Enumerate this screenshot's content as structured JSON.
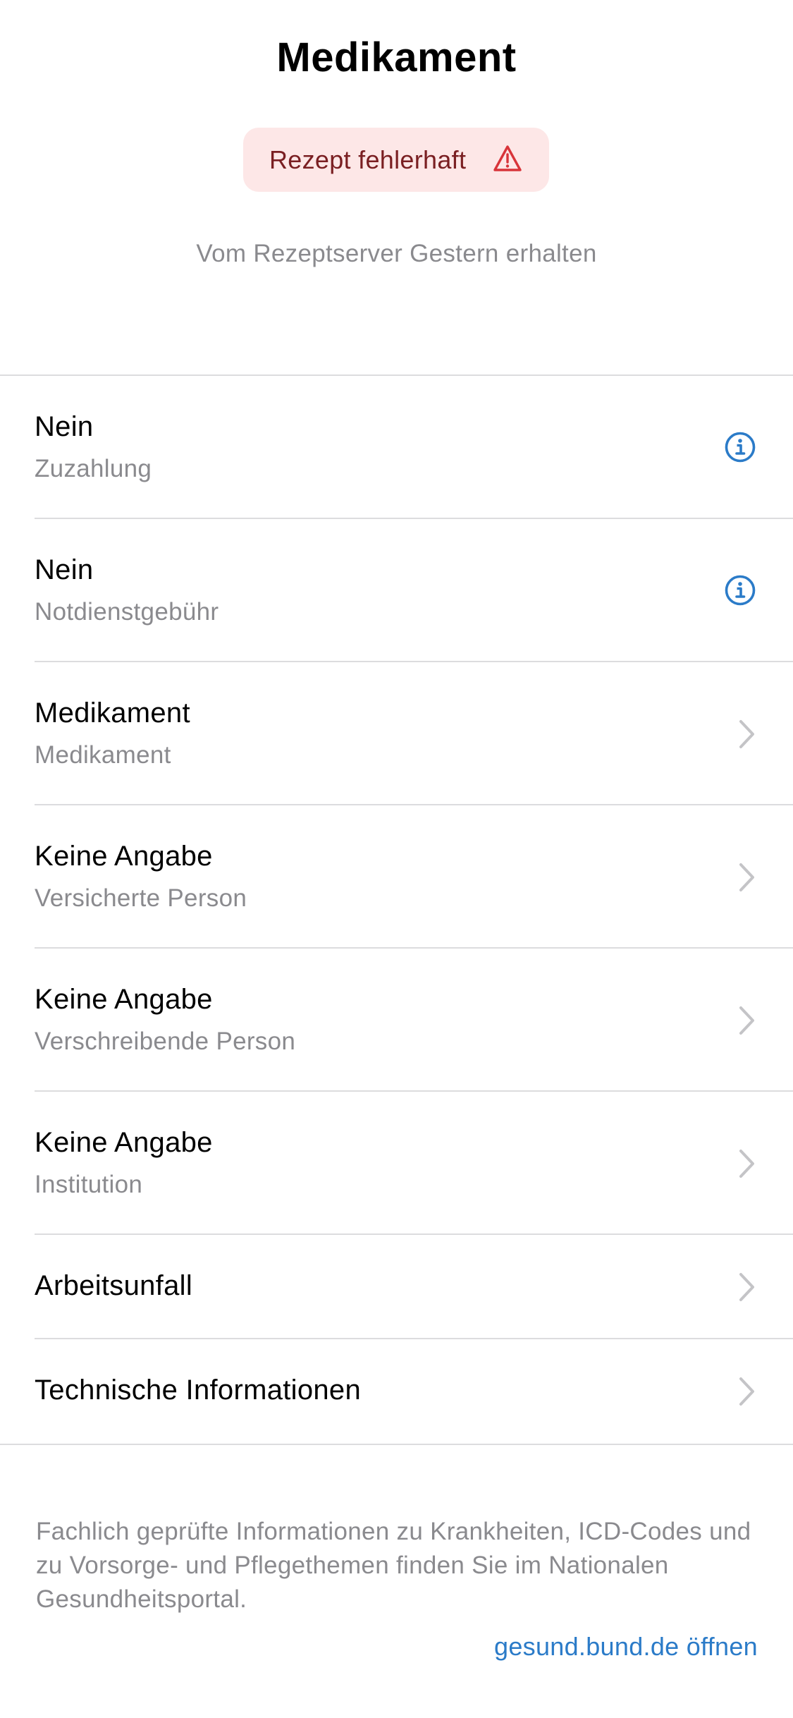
{
  "header": {
    "title": "Medikament"
  },
  "status": {
    "label": "Rezept fehlerhaft",
    "icon": "warning-triangle-icon",
    "color": "#d8343a",
    "background": "#fde7e7"
  },
  "received_text": "Vom Rezeptserver Gestern erhalten",
  "rows": [
    {
      "primary": "Nein",
      "secondary": "Zuzahlung",
      "accessory": "info-icon"
    },
    {
      "primary": "Nein",
      "secondary": "Notdienstgebühr",
      "accessory": "info-icon"
    },
    {
      "primary": "Medikament",
      "secondary": "Medikament",
      "accessory": "chevron-right-icon"
    },
    {
      "primary": "Keine Angabe",
      "secondary": "Versicherte Person",
      "accessory": "chevron-right-icon"
    },
    {
      "primary": "Keine Angabe",
      "secondary": "Verschreibende Person",
      "accessory": "chevron-right-icon"
    },
    {
      "primary": "Keine Angabe",
      "secondary": "Institution",
      "accessory": "chevron-right-icon"
    },
    {
      "primary": "Arbeitsunfall",
      "accessory": "chevron-right-icon"
    },
    {
      "primary": "Technische Informationen",
      "accessory": "chevron-right-icon"
    }
  ],
  "footer": {
    "text": "Fachlich geprüfte Informationen zu Krankheiten, ICD-Codes und zu Vorsorge- und Pflegethemen finden Sie im Nationalen Gesundheitsportal.",
    "link_label": "gesund.bund.de öffnen"
  },
  "colors": {
    "accent": "#2b7bc8",
    "secondary_text": "#8a8a8e",
    "separator": "#dcdcde",
    "chevron": "#c4c4c7"
  }
}
